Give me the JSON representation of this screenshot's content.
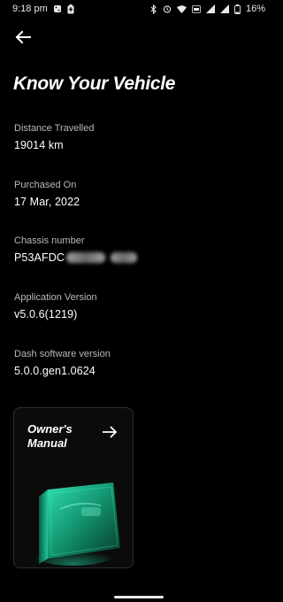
{
  "status_bar": {
    "time": "9:18 pm",
    "battery_percent": "16%",
    "left_icons": [
      "dice-icon",
      "battery-saver-icon"
    ],
    "right_icons": [
      "bluetooth-icon",
      "alarm-icon",
      "wifi-icon",
      "volte-icon",
      "signal-icon",
      "signal-icon",
      "battery-icon"
    ]
  },
  "header": {
    "back_icon": "arrow-left-icon",
    "title": "Know Your Vehicle"
  },
  "vehicle_info": [
    {
      "label": "Distance Travelled",
      "value": "19014 km"
    },
    {
      "label": "Purchased On",
      "value": "17 Mar, 2022"
    },
    {
      "label": "Chassis number",
      "value": "P53AFDC"
    },
    {
      "label": "Application Version",
      "value": "v5.0.6(1219)"
    },
    {
      "label": "Dash software version",
      "value": "5.0.0.gen1.0624"
    }
  ],
  "manual_card": {
    "title": "Owner's Manual",
    "arrow_icon": "arrow-right-icon",
    "illustration": "book-icon",
    "accent_color": "#1fc89b"
  }
}
